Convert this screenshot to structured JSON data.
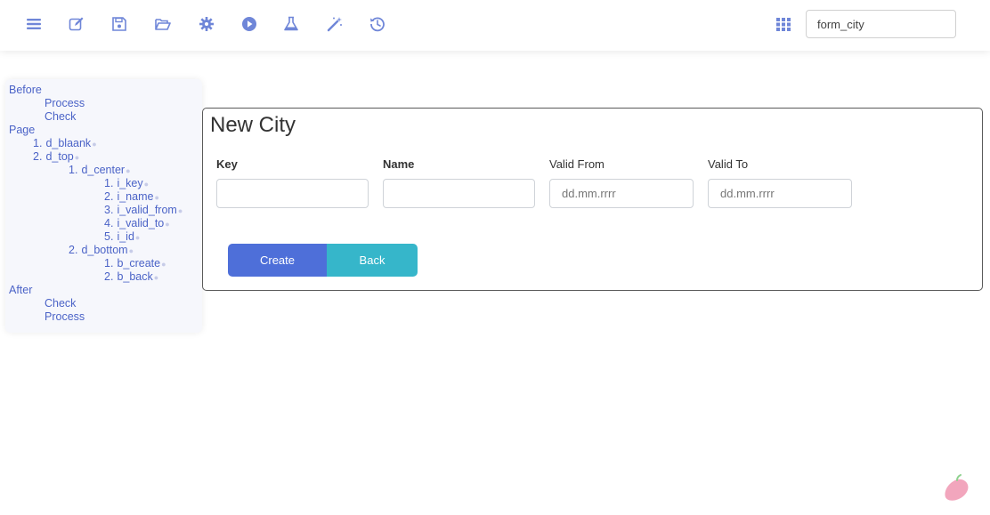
{
  "toolbar": {
    "icons": [
      "menu-icon",
      "edit-icon",
      "save-icon",
      "folder-open-icon",
      "gear-icon",
      "play-icon",
      "flask-icon",
      "magic-wand-icon",
      "history-icon"
    ],
    "grid_icon": "grid-icon",
    "search_value": "form_city"
  },
  "tree": {
    "before": "Before",
    "before_process": "Process",
    "before_check": "Check",
    "page": "Page",
    "n1": "1.",
    "d_blaank": "d_blaank",
    "n2": "2.",
    "d_top": "d_top",
    "n2_1": "1.",
    "d_center": "d_center",
    "n2_1_1": "1.",
    "i_key": "i_key",
    "n2_1_2": "2.",
    "i_name": "i_name",
    "n2_1_3": "3.",
    "i_valid_from": "i_valid_from",
    "n2_1_4": "4.",
    "i_valid_to": "i_valid_to",
    "n2_1_5": "5.",
    "i_id": "i_id",
    "n2_2": "2.",
    "d_bottom": "d_bottom",
    "n2_2_1": "1.",
    "b_create": "b_create",
    "n2_2_2": "2.",
    "b_back": "b_back",
    "after": "After",
    "after_check": "Check",
    "after_process": "Process"
  },
  "form": {
    "title": "New City",
    "key_label": "Key",
    "key_value": "",
    "name_label": "Name",
    "name_value": "",
    "valid_from_label": "Valid From",
    "valid_from_placeholder": "dd.mm.rrrr",
    "valid_to_label": "Valid To",
    "valid_to_placeholder": "dd.mm.rrrr",
    "create_label": "Create",
    "back_label": "Back"
  },
  "colors": {
    "icon": "#6f86d8",
    "tree_text": "#4b63c7",
    "create_button": "#4e6fd9",
    "back_button": "#36b6ca"
  }
}
